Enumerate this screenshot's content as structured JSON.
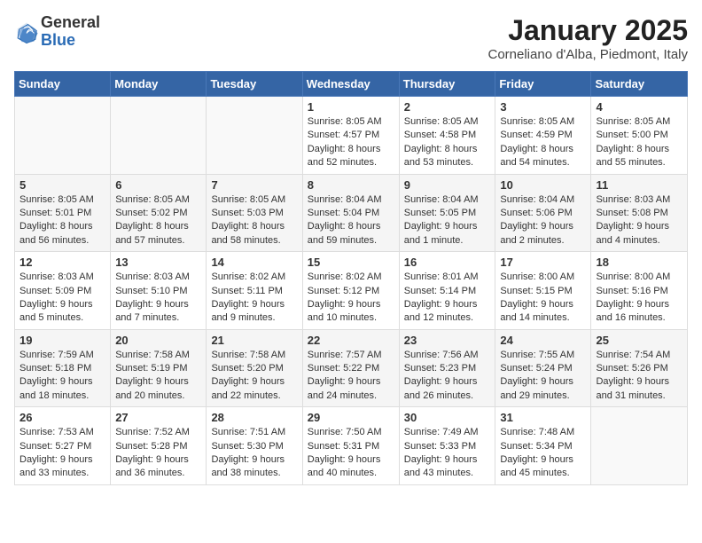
{
  "header": {
    "logo_line1": "General",
    "logo_line2": "Blue",
    "title": "January 2025",
    "subtitle": "Corneliano d'Alba, Piedmont, Italy"
  },
  "weekdays": [
    "Sunday",
    "Monday",
    "Tuesday",
    "Wednesday",
    "Thursday",
    "Friday",
    "Saturday"
  ],
  "weeks": [
    [
      {
        "day": "",
        "info": ""
      },
      {
        "day": "",
        "info": ""
      },
      {
        "day": "",
        "info": ""
      },
      {
        "day": "1",
        "info": "Sunrise: 8:05 AM\nSunset: 4:57 PM\nDaylight: 8 hours and 52 minutes."
      },
      {
        "day": "2",
        "info": "Sunrise: 8:05 AM\nSunset: 4:58 PM\nDaylight: 8 hours and 53 minutes."
      },
      {
        "day": "3",
        "info": "Sunrise: 8:05 AM\nSunset: 4:59 PM\nDaylight: 8 hours and 54 minutes."
      },
      {
        "day": "4",
        "info": "Sunrise: 8:05 AM\nSunset: 5:00 PM\nDaylight: 8 hours and 55 minutes."
      }
    ],
    [
      {
        "day": "5",
        "info": "Sunrise: 8:05 AM\nSunset: 5:01 PM\nDaylight: 8 hours and 56 minutes."
      },
      {
        "day": "6",
        "info": "Sunrise: 8:05 AM\nSunset: 5:02 PM\nDaylight: 8 hours and 57 minutes."
      },
      {
        "day": "7",
        "info": "Sunrise: 8:05 AM\nSunset: 5:03 PM\nDaylight: 8 hours and 58 minutes."
      },
      {
        "day": "8",
        "info": "Sunrise: 8:04 AM\nSunset: 5:04 PM\nDaylight: 8 hours and 59 minutes."
      },
      {
        "day": "9",
        "info": "Sunrise: 8:04 AM\nSunset: 5:05 PM\nDaylight: 9 hours and 1 minute."
      },
      {
        "day": "10",
        "info": "Sunrise: 8:04 AM\nSunset: 5:06 PM\nDaylight: 9 hours and 2 minutes."
      },
      {
        "day": "11",
        "info": "Sunrise: 8:03 AM\nSunset: 5:08 PM\nDaylight: 9 hours and 4 minutes."
      }
    ],
    [
      {
        "day": "12",
        "info": "Sunrise: 8:03 AM\nSunset: 5:09 PM\nDaylight: 9 hours and 5 minutes."
      },
      {
        "day": "13",
        "info": "Sunrise: 8:03 AM\nSunset: 5:10 PM\nDaylight: 9 hours and 7 minutes."
      },
      {
        "day": "14",
        "info": "Sunrise: 8:02 AM\nSunset: 5:11 PM\nDaylight: 9 hours and 9 minutes."
      },
      {
        "day": "15",
        "info": "Sunrise: 8:02 AM\nSunset: 5:12 PM\nDaylight: 9 hours and 10 minutes."
      },
      {
        "day": "16",
        "info": "Sunrise: 8:01 AM\nSunset: 5:14 PM\nDaylight: 9 hours and 12 minutes."
      },
      {
        "day": "17",
        "info": "Sunrise: 8:00 AM\nSunset: 5:15 PM\nDaylight: 9 hours and 14 minutes."
      },
      {
        "day": "18",
        "info": "Sunrise: 8:00 AM\nSunset: 5:16 PM\nDaylight: 9 hours and 16 minutes."
      }
    ],
    [
      {
        "day": "19",
        "info": "Sunrise: 7:59 AM\nSunset: 5:18 PM\nDaylight: 9 hours and 18 minutes."
      },
      {
        "day": "20",
        "info": "Sunrise: 7:58 AM\nSunset: 5:19 PM\nDaylight: 9 hours and 20 minutes."
      },
      {
        "day": "21",
        "info": "Sunrise: 7:58 AM\nSunset: 5:20 PM\nDaylight: 9 hours and 22 minutes."
      },
      {
        "day": "22",
        "info": "Sunrise: 7:57 AM\nSunset: 5:22 PM\nDaylight: 9 hours and 24 minutes."
      },
      {
        "day": "23",
        "info": "Sunrise: 7:56 AM\nSunset: 5:23 PM\nDaylight: 9 hours and 26 minutes."
      },
      {
        "day": "24",
        "info": "Sunrise: 7:55 AM\nSunset: 5:24 PM\nDaylight: 9 hours and 29 minutes."
      },
      {
        "day": "25",
        "info": "Sunrise: 7:54 AM\nSunset: 5:26 PM\nDaylight: 9 hours and 31 minutes."
      }
    ],
    [
      {
        "day": "26",
        "info": "Sunrise: 7:53 AM\nSunset: 5:27 PM\nDaylight: 9 hours and 33 minutes."
      },
      {
        "day": "27",
        "info": "Sunrise: 7:52 AM\nSunset: 5:28 PM\nDaylight: 9 hours and 36 minutes."
      },
      {
        "day": "28",
        "info": "Sunrise: 7:51 AM\nSunset: 5:30 PM\nDaylight: 9 hours and 38 minutes."
      },
      {
        "day": "29",
        "info": "Sunrise: 7:50 AM\nSunset: 5:31 PM\nDaylight: 9 hours and 40 minutes."
      },
      {
        "day": "30",
        "info": "Sunrise: 7:49 AM\nSunset: 5:33 PM\nDaylight: 9 hours and 43 minutes."
      },
      {
        "day": "31",
        "info": "Sunrise: 7:48 AM\nSunset: 5:34 PM\nDaylight: 9 hours and 45 minutes."
      },
      {
        "day": "",
        "info": ""
      }
    ]
  ]
}
